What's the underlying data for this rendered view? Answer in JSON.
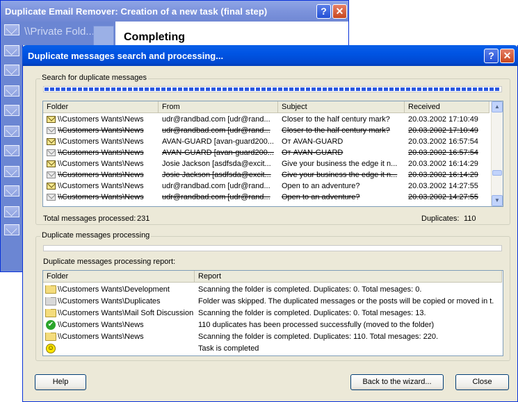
{
  "background_window": {
    "title": "Duplicate Email Remover: Creation of a new task (final step)",
    "sidebar_text": "\\\\Private Fold...",
    "heading": "Completing"
  },
  "dialog": {
    "title": "Duplicate messages search and processing...",
    "search_group": {
      "legend": "Search for duplicate messages",
      "progress": 1.0,
      "columns": [
        "Folder",
        "From",
        "Subject",
        "Received"
      ],
      "rows": [
        {
          "folder": "\\\\Customers Wants\\News",
          "from": "udr@randbad.com [udr@rand...",
          "subject": "Closer to the half century mark?",
          "received": "20.03.2002 17:10:49",
          "duplicate": false
        },
        {
          "folder": "\\\\Customers Wants\\News",
          "from": "udr@randbad.com [udr@rand...",
          "subject": "Closer to the half century mark?",
          "received": "20.03.2002 17:10:49",
          "duplicate": true
        },
        {
          "folder": "\\\\Customers Wants\\News",
          "from": "AVAN-GUARD [avan-guard200...",
          "subject": "От AVAN-GUARD",
          "received": "20.03.2002 16:57:54",
          "duplicate": false
        },
        {
          "folder": "\\\\Customers Wants\\News",
          "from": "AVAN-GUARD [avan-guard200...",
          "subject": "От AVAN-GUARD",
          "received": "20.03.2002 16:57:54",
          "duplicate": true
        },
        {
          "folder": "\\\\Customers Wants\\News",
          "from": "Josie Jackson [asdfsda@excit...",
          "subject": "Give your business the edge it n...",
          "received": "20.03.2002 16:14:29",
          "duplicate": false
        },
        {
          "folder": "\\\\Customers Wants\\News",
          "from": "Josie Jackson [asdfsda@excit...",
          "subject": "Give your business the edge it n...",
          "received": "20.03.2002 16:14:29",
          "duplicate": true
        },
        {
          "folder": "\\\\Customers Wants\\News",
          "from": "udr@randbad.com [udr@rand...",
          "subject": "Open to an adventure?",
          "received": "20.03.2002 14:27:55",
          "duplicate": false
        },
        {
          "folder": "\\\\Customers Wants\\News",
          "from": "udr@randbad.com [udr@rand...",
          "subject": "Open to an adventure?",
          "received": "20.03.2002 14:27:55",
          "duplicate": true
        }
      ],
      "total_label": "Total messages processed:",
      "total_value": "231",
      "duplicates_label": "Duplicates:",
      "duplicates_value": "110"
    },
    "processing_group": {
      "legend": "Duplicate messages processing",
      "progress": 0.0,
      "report_label": "Duplicate messages processing report:",
      "columns": [
        "Folder",
        "Report"
      ],
      "rows": [
        {
          "icon": "folder-icon",
          "folder": "\\\\Customers Wants\\Development",
          "report": "Scanning the folder is completed. Duplicates: 0. Total mesages: 0."
        },
        {
          "icon": "folder-grey-icon",
          "folder": "\\\\Customers Wants\\Duplicates",
          "report": "Folder was skipped. The duplicated messages or the posts will be copied or moved in t..."
        },
        {
          "icon": "folder-icon",
          "folder": "\\\\Customers Wants\\Mail Soft Discussion",
          "report": "Scanning the folder is completed. Duplicates: 0. Total mesages: 13."
        },
        {
          "icon": "check-icon",
          "folder": "\\\\Customers Wants\\News",
          "report": "110 duplicates has been processed successfully (moved to the folder)"
        },
        {
          "icon": "folder-icon",
          "folder": "\\\\Customers Wants\\News",
          "report": "Scanning the folder is completed. Duplicates: 110. Total mesages: 220."
        },
        {
          "icon": "smiley-icon",
          "folder": "",
          "report": "Task is completed"
        }
      ]
    },
    "buttons": {
      "help": "Help",
      "back": "Back to the wizard...",
      "close": "Close"
    }
  },
  "colors": {
    "titlebar": "#0054e3",
    "dialog_bg": "#ece9d8",
    "progress": "#2b58e0"
  }
}
